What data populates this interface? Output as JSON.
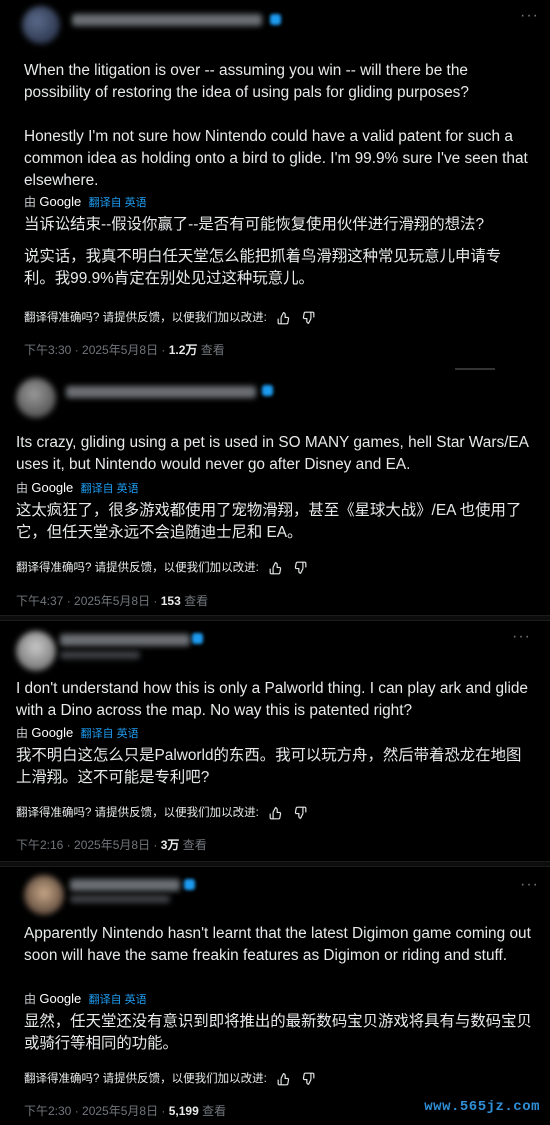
{
  "posts": [
    {
      "body": [
        "When the litigation is over -- assuming you win -- will there be the possibility of restoring the idea of using pals for gliding purposes?",
        "Honestly I'm not sure how Nintendo could have a valid patent for such a common idea as holding onto a bird to glide. I'm 99.9% sure I've seen that elsewhere."
      ],
      "translated_by": "由",
      "translator": "Google",
      "translated_from": "翻译自 英语",
      "translation": [
        "当诉讼结束--假设你赢了--是否有可能恢复使用伙伴进行滑翔的想法?",
        "说实话，我真不明白任天堂怎么能把抓着鸟滑翔这种常见玩意儿申请专利。我99.9%肯定在别处见过这种玩意儿。"
      ],
      "feedback_prompt": "翻译得准确吗? 请提供反馈，以便我们加以改进:",
      "time": "下午3:30 · 2025年5月8日 · ",
      "views": "1.2万",
      "views_label": " 查看"
    },
    {
      "body": [
        "Its crazy, gliding using a pet is used in SO MANY games, hell Star Wars/EA uses it, but Nintendo would never go after Disney and EA."
      ],
      "translated_by": "由",
      "translator": "Google",
      "translated_from": "翻译自 英语",
      "translation": [
        "这太疯狂了，很多游戏都使用了宠物滑翔，甚至《星球大战》/EA 也使用了它，但任天堂永远不会追随迪士尼和 EA。"
      ],
      "feedback_prompt": "翻译得准确吗? 请提供反馈，以便我们加以改进:",
      "time": "下午4:37 · 2025年5月8日 · ",
      "views": "153",
      "views_label": " 查看"
    },
    {
      "body": [
        "I don't understand how this is only a Palworld thing. I can play ark and glide with a Dino across the map. No way this is patented right?"
      ],
      "translated_by": "由",
      "translator": "Google",
      "translated_from": "翻译自 英语",
      "translation": [
        "我不明白这怎么只是Palworld的东西。我可以玩方舟，然后带着恐龙在地图上滑翔。这不可能是专利吧?"
      ],
      "feedback_prompt": "翻译得准确吗? 请提供反馈，以便我们加以改进:",
      "time": "下午2:16 · 2025年5月8日 · ",
      "views": "3万",
      "views_label": " 查看"
    },
    {
      "body": [
        "Apparently Nintendo hasn't learnt that the latest Digimon game coming out soon will have the same freakin features as Digimon or riding and stuff."
      ],
      "translated_by": "由",
      "translator": "Google",
      "translated_from": "翻译自 英语",
      "translation": [
        "显然，任天堂还没有意识到即将推出的最新数码宝贝游戏将具有与数码宝贝或骑行等相同的功能。"
      ],
      "feedback_prompt": "翻译得准确吗? 请提供反馈，以便我们加以改进:",
      "time": "下午2:30 · 2025年5月8日 · ",
      "views": "5,199",
      "views_label": " 查看"
    }
  ],
  "more_icon": "more-horizontal-icon",
  "thumbs_up_icon": "thumbs-up-icon",
  "thumbs_down_icon": "thumbs-down-icon",
  "watermark": "www.565jz.com",
  "colors": {
    "background": "#000000",
    "text": "#e7e9ea",
    "muted": "#71767b",
    "accent": "#1d9bf0"
  }
}
